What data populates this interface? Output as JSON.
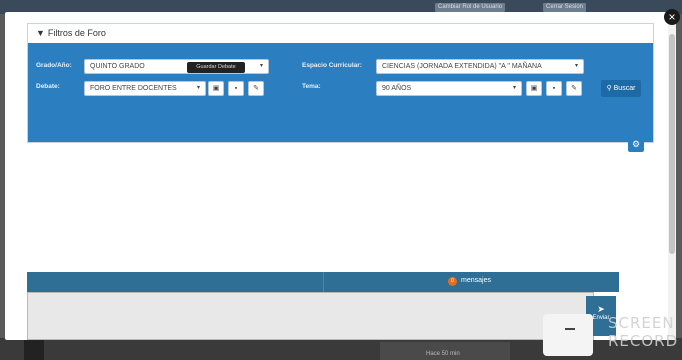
{
  "background": {
    "top_buttons": [
      "Cambiar Rol de Usuario",
      "Cerrar Sesion"
    ],
    "bottom_text": "Hace 50 min"
  },
  "modal": {
    "close_glyph": "×",
    "filters": {
      "title": "Filtros de Foro",
      "title_icon": "funnel-icon",
      "grado_label": "Grado/Año:",
      "grado_value": "QUINTO GRADO",
      "espacio_label": "Espacio Curricular:",
      "espacio_value": "CIENCIAS (JORNADA EXTENDIDA) \"A \" MAÑANA",
      "debate_label": "Debate:",
      "debate_value": "FORO ENTRE DOCENTES",
      "tema_label": "Tema:",
      "tema_value": "90 AÑOS",
      "tooltip": "Guardar Debate",
      "buscar_label": "Buscar"
    },
    "chat": {
      "badge_count": "0",
      "messages_label": "mensajes",
      "send_label": "Enviar"
    }
  },
  "watermark": {
    "line1": "SCREEN",
    "line2": "RECORD"
  },
  "colors": {
    "panel_blue": "#2b7fc0",
    "chat_bar": "#2f6e95",
    "badge": "#e07020"
  }
}
